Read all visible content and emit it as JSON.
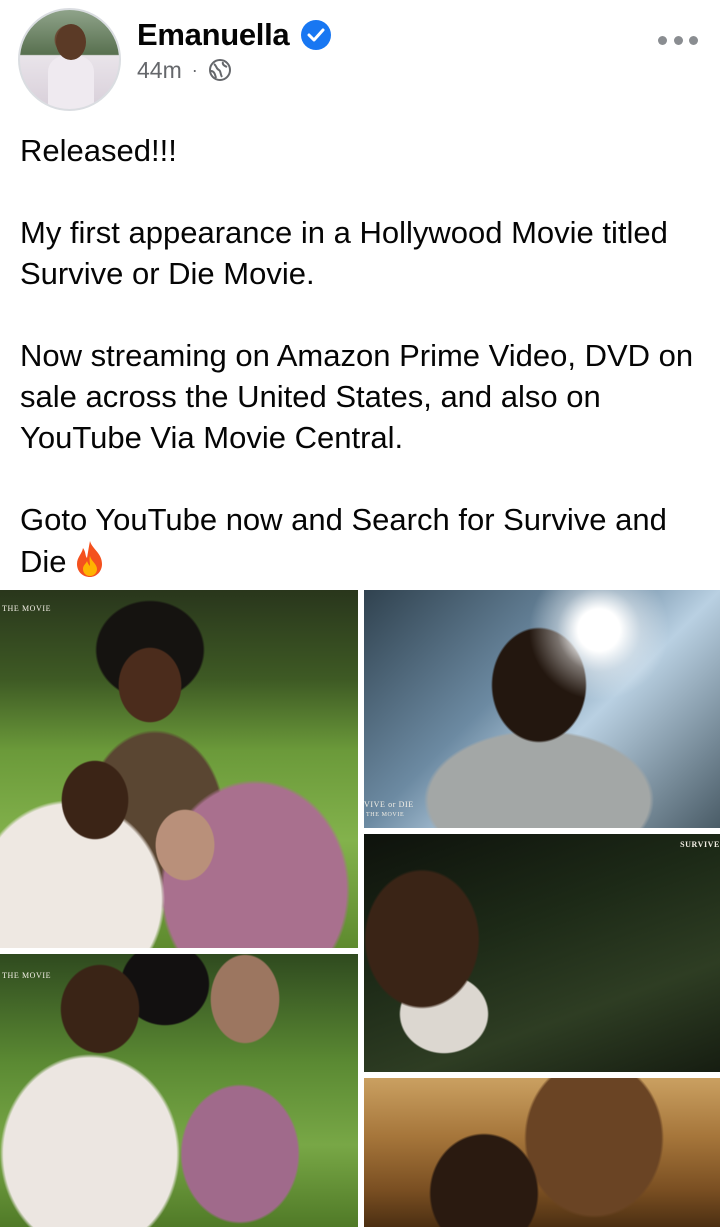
{
  "post": {
    "author": "Emanuella",
    "verified": true,
    "time": "44m",
    "separator": "·",
    "audience_icon": "globe-icon",
    "text": "Released!!!\n\nMy first appearance in a Hollywood  Movie titled Survive or Die Movie.\n\nNow streaming on Amazon Prime Video, DVD on sale across the United States, and also on YouTube Via Movie Central.\n\nGoto YouTube now and Search for Survive and Die",
    "emoji": "fire-emoji"
  },
  "photos": [
    {
      "caption": "THE MOVIE"
    },
    {
      "caption": "VIVE or DIE",
      "caption2": "THE MOVIE"
    },
    {
      "caption": "SURVIVE"
    },
    {
      "caption": "THE MOVIE"
    },
    {
      "caption": ""
    }
  ],
  "colors": {
    "verified_badge": "#1877f2",
    "meta_text": "#65676b",
    "more_dots": "#8a8d91"
  }
}
